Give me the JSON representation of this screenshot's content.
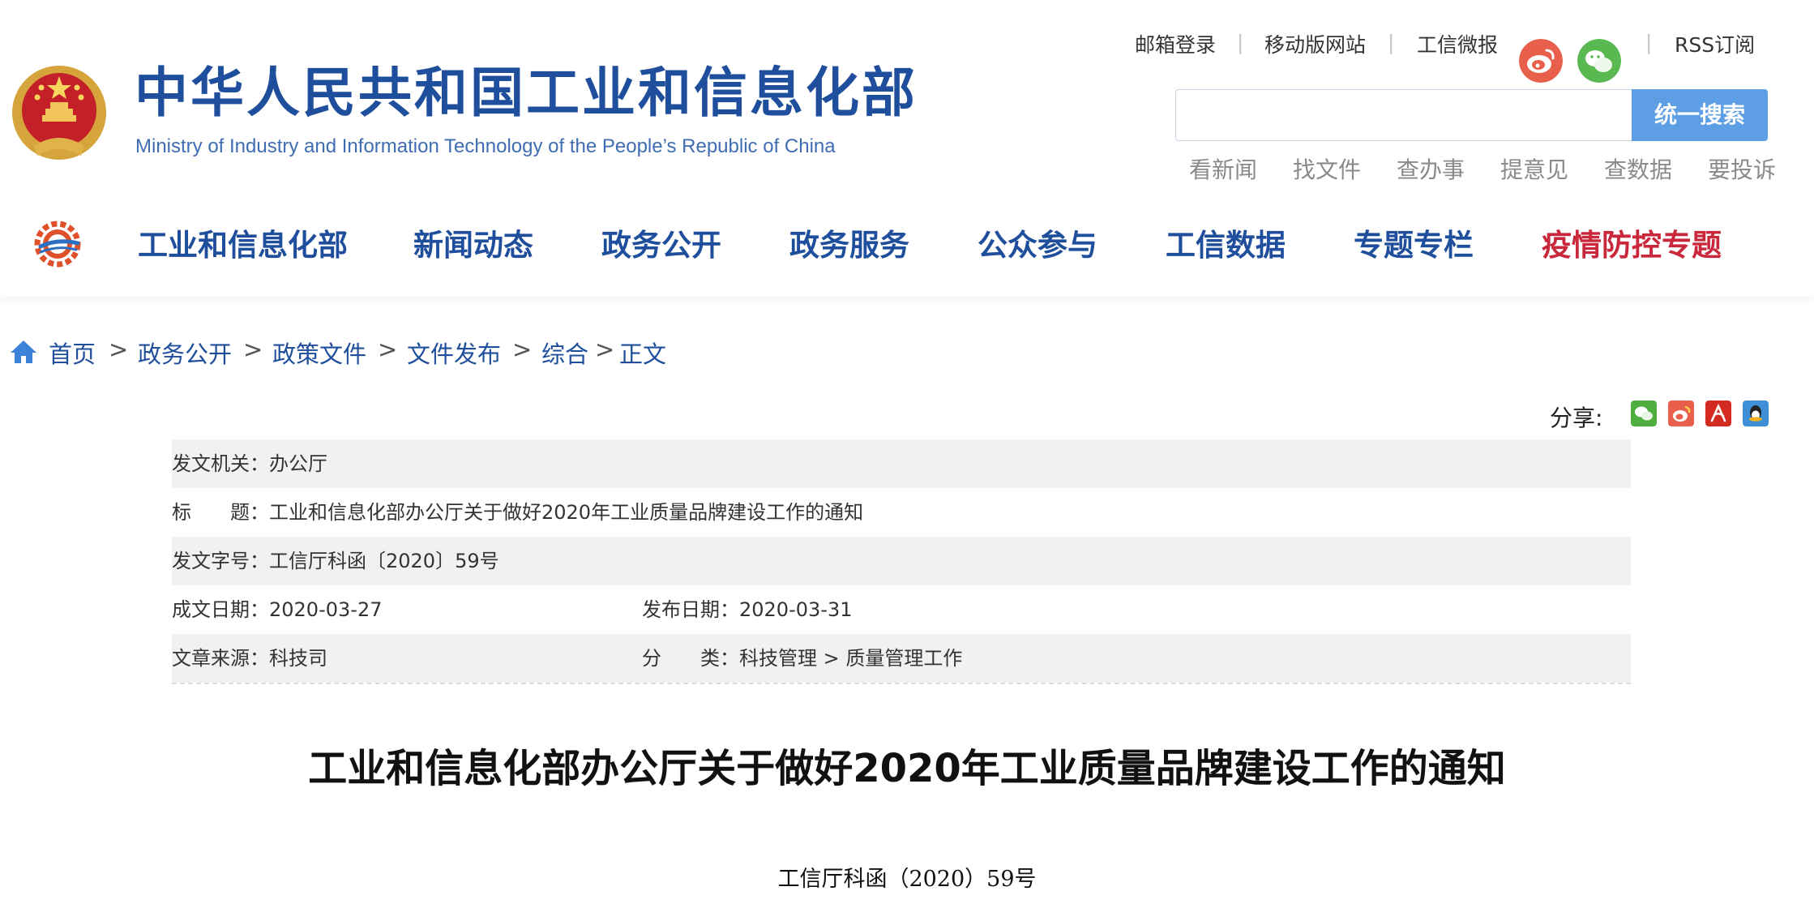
{
  "header": {
    "site_title": "中华人民共和国工业和信息化部",
    "site_subtitle": "Ministry of Industry and Information Technology of the People’s Republic of China",
    "top_links": [
      "邮箱登录",
      "移动版网站",
      "工信微报",
      "RSS订阅"
    ],
    "search": {
      "placeholder": "",
      "button_label": "统一搜索"
    },
    "quick_links": [
      "看新闻",
      "找文件",
      "查办事",
      "提意见",
      "查数据",
      "要投诉"
    ],
    "nav": [
      "工业和信息化部",
      "新闻动态",
      "政务公开",
      "政务服务",
      "公众参与",
      "工信数据",
      "专题专栏",
      "疫情防控专题"
    ],
    "colors": {
      "brand_blue": "#1f4f9c",
      "search_button": "#5d9ee4",
      "highlight_red": "#c9283c"
    },
    "icons": [
      "national-emblem-icon",
      "weibo-icon",
      "wechat-icon",
      "ministry-logo-icon"
    ]
  },
  "breadcrumb": {
    "items": [
      "首页",
      "政务公开",
      "政策文件",
      "文件发布",
      "综合",
      "正文"
    ],
    "separator": ">"
  },
  "share": {
    "label": "分享:",
    "icons": [
      "wechat-share-icon",
      "weibo-share-icon",
      "pdf-icon",
      "qq-share-icon"
    ]
  },
  "meta": {
    "issuer": {
      "label": "发文机关：",
      "value": "办公厅"
    },
    "title": {
      "label": "标　　题：",
      "value": "工业和信息化部办公厅关于做好2020年工业质量品牌建设工作的通知"
    },
    "doc_number": {
      "label": "发文字号：",
      "value": "工信厅科函〔2020〕59号"
    },
    "written_date": {
      "label": "成文日期：",
      "value": "2020-03-27"
    },
    "publish_date": {
      "label": "发布日期：",
      "value": "2020-03-31"
    },
    "source": {
      "label": "文章来源：",
      "value": "科技司"
    },
    "category": {
      "label": "分　　类：",
      "value": "科技管理 > 质量管理工作"
    }
  },
  "article": {
    "title": "工业和信息化部办公厅关于做好2020年工业质量品牌建设工作的通知",
    "doc_number": "工信厅科函（2020）59号"
  }
}
